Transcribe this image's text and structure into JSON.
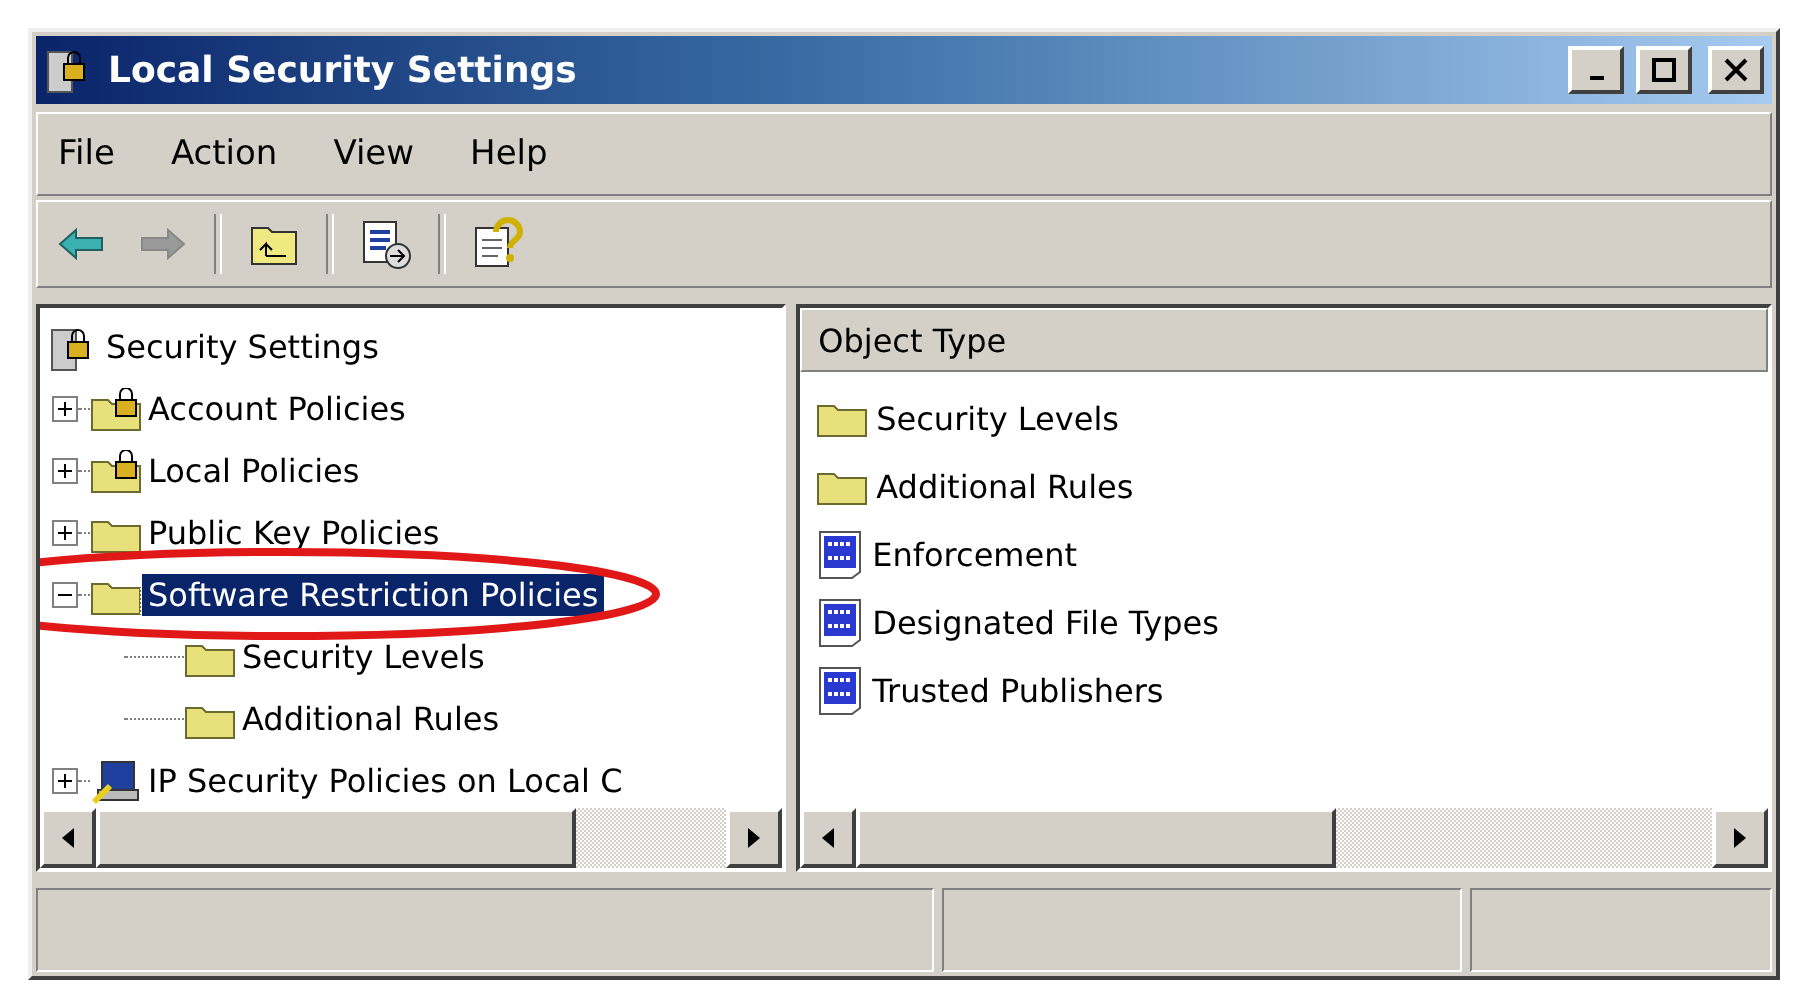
{
  "window": {
    "title": "Local Security Settings"
  },
  "menu": [
    "File",
    "Action",
    "View",
    "Help"
  ],
  "toolbar": [
    {
      "kind": "back",
      "disabled": false
    },
    {
      "kind": "forward",
      "disabled": true
    },
    {
      "kind": "separator"
    },
    {
      "kind": "up"
    },
    {
      "kind": "separator"
    },
    {
      "kind": "export"
    },
    {
      "kind": "separator"
    },
    {
      "kind": "help"
    }
  ],
  "tree": {
    "root": {
      "label": "Security Settings",
      "kind": "server"
    },
    "items": [
      {
        "label": "Account Policies",
        "kind": "lock-folder",
        "expanded": false,
        "selected": false,
        "circled": false
      },
      {
        "label": "Local Policies",
        "kind": "lock-folder",
        "expanded": false,
        "selected": false,
        "circled": false
      },
      {
        "label": "Public Key Policies",
        "kind": "folder",
        "expanded": false,
        "selected": false,
        "circled": false
      },
      {
        "label": "Software Restriction Policies",
        "kind": "folder",
        "expanded": true,
        "selected": true,
        "circled": true,
        "children": [
          {
            "label": "Security Levels",
            "kind": "folder"
          },
          {
            "label": "Additional Rules",
            "kind": "folder"
          }
        ]
      },
      {
        "label": "IP Security Policies on Local C",
        "kind": "computer",
        "expanded": false,
        "selected": false,
        "circled": false
      }
    ]
  },
  "list": {
    "columns": [
      "Object Type"
    ],
    "rows": [
      {
        "label": "Security Levels",
        "kind": "folder"
      },
      {
        "label": "Additional Rules",
        "kind": "folder"
      },
      {
        "label": "Enforcement",
        "kind": "binary"
      },
      {
        "label": "Designated File Types",
        "kind": "binary"
      },
      {
        "label": "Trusted Publishers",
        "kind": "binary"
      }
    ]
  }
}
